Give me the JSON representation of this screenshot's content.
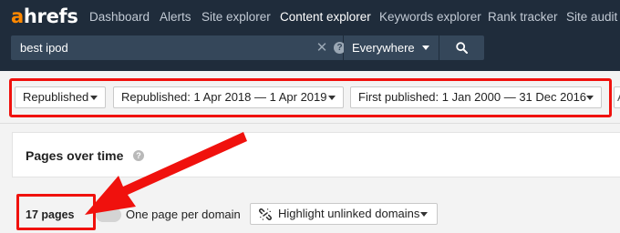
{
  "brand": {
    "logo_a": "a",
    "logo_rest": "hrefs",
    "accent": "#ff8800"
  },
  "nav": {
    "items": [
      {
        "label": "Dashboard"
      },
      {
        "label": "Alerts"
      },
      {
        "label": "Site explorer"
      },
      {
        "label": "Content explorer",
        "active": true
      },
      {
        "label": "Keywords explorer"
      },
      {
        "label": "Rank tracker"
      },
      {
        "label": "Site audit"
      }
    ]
  },
  "search": {
    "value": "best ipod",
    "scope": "Everywhere",
    "clear_icon": "close-icon",
    "help_icon": "help-icon",
    "submit_icon": "search-icon"
  },
  "filters": {
    "items": [
      {
        "label": "Republished"
      },
      {
        "label": "Republished: 1 Apr 2018 — 1 Apr 2019"
      },
      {
        "label": "First published: 1 Jan 2000 — 31 Dec 2016"
      }
    ],
    "more_label": "A"
  },
  "pages_over_time": {
    "title": "Pages over time",
    "help_icon": "help-icon"
  },
  "results": {
    "count_label": "17 pages",
    "one_per_domain_label": "One page per domain",
    "one_per_domain_on": false,
    "highlight_label": "Highlight unlinked domains",
    "highlight_icon": "broken-link-icon"
  },
  "annotation": {
    "color": "#f0110d"
  }
}
